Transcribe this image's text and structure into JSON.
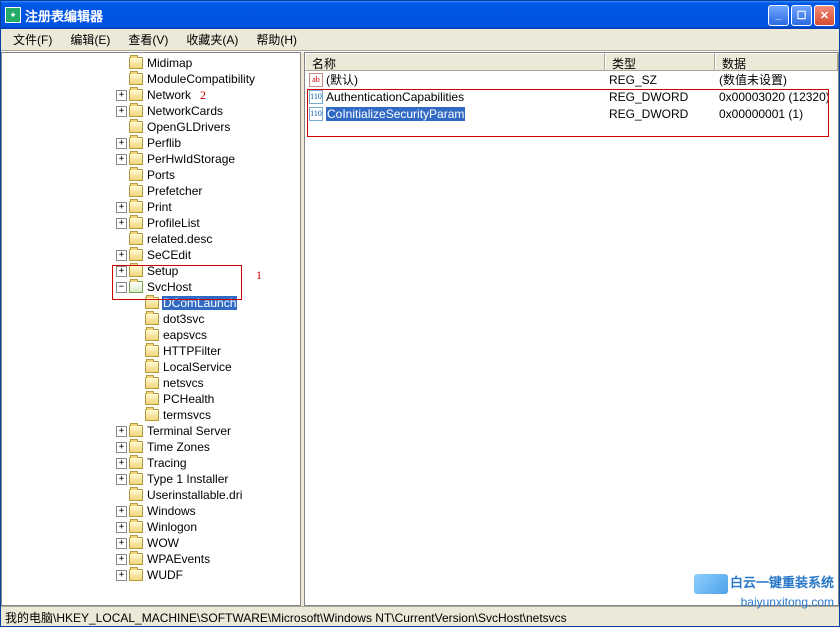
{
  "title": "注册表编辑器",
  "menu": {
    "file": "文件(F)",
    "edit": "编辑(E)",
    "view": "查看(V)",
    "fav": "收藏夹(A)",
    "help": "帮助(H)"
  },
  "annotations": {
    "one": "1",
    "two": "2"
  },
  "tree": {
    "root_indent_levels": 7,
    "nodes": [
      {
        "label": "Midimap",
        "kind": "leaf",
        "depth": 7
      },
      {
        "label": "ModuleCompatibility",
        "kind": "leaf",
        "depth": 7
      },
      {
        "label": "Network",
        "kind": "plus",
        "depth": 7,
        "ann": "two"
      },
      {
        "label": "NetworkCards",
        "kind": "plus",
        "depth": 7
      },
      {
        "label": "OpenGLDrivers",
        "kind": "leaf",
        "depth": 7
      },
      {
        "label": "Perflib",
        "kind": "plus",
        "depth": 7
      },
      {
        "label": "PerHwIdStorage",
        "kind": "plus",
        "depth": 7
      },
      {
        "label": "Ports",
        "kind": "leaf",
        "depth": 7
      },
      {
        "label": "Prefetcher",
        "kind": "leaf",
        "depth": 7
      },
      {
        "label": "Print",
        "kind": "plus",
        "depth": 7
      },
      {
        "label": "ProfileList",
        "kind": "plus",
        "depth": 7
      },
      {
        "label": "related.desc",
        "kind": "leaf",
        "depth": 7
      },
      {
        "label": "SeCEdit",
        "kind": "plus",
        "depth": 7
      },
      {
        "label": "Setup",
        "kind": "plus",
        "depth": 7,
        "ann": "one_box_start"
      },
      {
        "label": "SvcHost",
        "kind": "minus",
        "depth": 7,
        "open": true
      },
      {
        "label": "DComLaunch",
        "kind": "leaf",
        "depth": 8,
        "selected": true
      },
      {
        "label": "dot3svc",
        "kind": "leaf",
        "depth": 8
      },
      {
        "label": "eapsvcs",
        "kind": "leaf",
        "depth": 8
      },
      {
        "label": "HTTPFilter",
        "kind": "leaf",
        "depth": 8
      },
      {
        "label": "LocalService",
        "kind": "leaf",
        "depth": 8
      },
      {
        "label": "netsvcs",
        "kind": "leaf",
        "depth": 8
      },
      {
        "label": "PCHealth",
        "kind": "leaf",
        "depth": 8
      },
      {
        "label": "termsvcs",
        "kind": "leaf",
        "depth": 8
      },
      {
        "label": "Terminal Server",
        "kind": "plus",
        "depth": 7
      },
      {
        "label": "Time Zones",
        "kind": "plus",
        "depth": 7
      },
      {
        "label": "Tracing",
        "kind": "plus",
        "depth": 7
      },
      {
        "label": "Type 1 Installer",
        "kind": "plus",
        "depth": 7
      },
      {
        "label": "Userinstallable.dri",
        "kind": "leaf",
        "depth": 7
      },
      {
        "label": "Windows",
        "kind": "plus",
        "depth": 7
      },
      {
        "label": "Winlogon",
        "kind": "plus",
        "depth": 7
      },
      {
        "label": "WOW",
        "kind": "plus",
        "depth": 7
      },
      {
        "label": "WPAEvents",
        "kind": "plus",
        "depth": 7
      },
      {
        "label": "WUDF",
        "kind": "plus",
        "depth": 7
      }
    ]
  },
  "columns": {
    "name": "名称",
    "type": "类型",
    "data": "数据"
  },
  "rows": [
    {
      "icon": "str",
      "name": "(默认)",
      "type": "REG_SZ",
      "data": "(数值未设置)",
      "sel": false
    },
    {
      "icon": "bin",
      "name": "AuthenticationCapabilities",
      "type": "REG_DWORD",
      "data": "0x00003020 (12320)",
      "sel": false
    },
    {
      "icon": "bin",
      "name": "CoInitializeSecurityParam",
      "type": "REG_DWORD",
      "data": "0x00000001 (1)",
      "sel": true
    }
  ],
  "icon_glyph": {
    "str": "ab",
    "bin": "011\n110"
  },
  "statusbar": "我的电脑\\HKEY_LOCAL_MACHINE\\SOFTWARE\\Microsoft\\Windows NT\\CurrentVersion\\SvcHost\\netsvcs",
  "watermark": {
    "cn": "白云一键重装系统",
    "url": "baiyunxitong.com"
  }
}
